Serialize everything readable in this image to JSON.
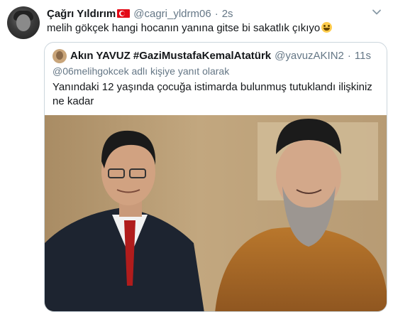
{
  "tweet": {
    "author_name": "Çağrı Yıldırım",
    "author_handle": "@cagri_yldrm06",
    "separator": "·",
    "time": "2s",
    "text": "melih gökçek hangi hocanın yanına gitse bi sakatlık çıkıyo"
  },
  "quoted_tweet": {
    "author_name": "Akın YAVUZ #GaziMustafaKemalAtatürk",
    "author_handle": "@yavuzAKIN2",
    "separator": "·",
    "time": "11s",
    "reply_context": "@06melihgokcek adlı kişiye yanıt olarak",
    "text": "Yanındaki 12 yaşında çocuğa istimarda bulunmuş tutuklandı ilişkiniz ne kadar"
  },
  "icons": {
    "flag": "turkey-flag-icon",
    "emoji": "grinning-face-icon",
    "menu": "chevron-down-icon"
  },
  "colors": {
    "text": "#14171a",
    "muted": "#657786",
    "border": "#ccd6dd",
    "flag_red": "#e30a17"
  }
}
